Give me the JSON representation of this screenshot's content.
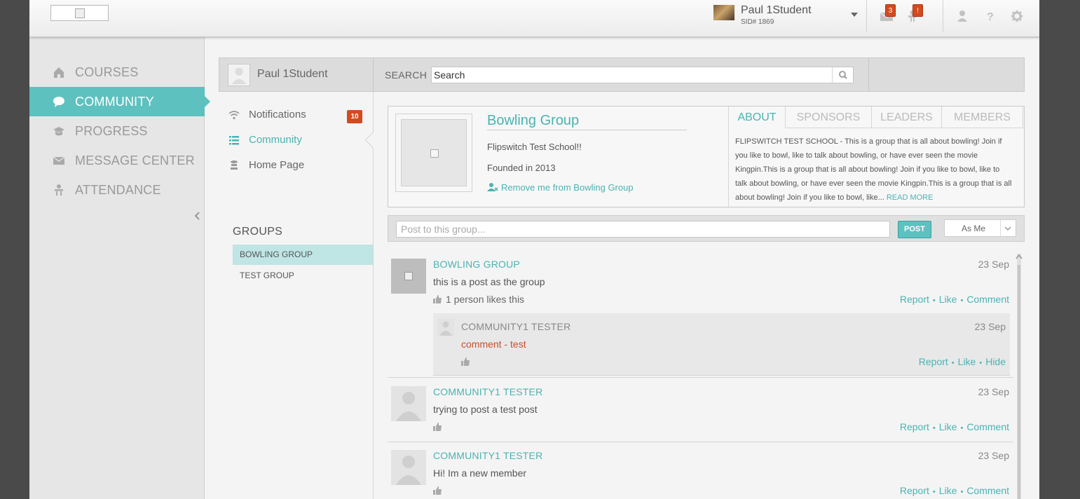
{
  "colors": {
    "accent": "#5dc1c0",
    "badge": "#d34a1f",
    "comment_text": "#c8502a"
  },
  "topbar": {
    "user_name": "Paul 1Student",
    "user_sid": "SID# 1869",
    "messages_badge": "3",
    "alerts_badge": "!",
    "icons": [
      "mail-icon",
      "alert-person-icon",
      "profile-icon",
      "help-icon",
      "settings-icon"
    ]
  },
  "sidebar": {
    "items": [
      {
        "label": "COURSES",
        "icon": "home-icon"
      },
      {
        "label": "COMMUNITY",
        "icon": "speech-bubble-icon",
        "active": true
      },
      {
        "label": "PROGRESS",
        "icon": "graduation-cap-icon"
      },
      {
        "label": "MESSAGE CENTER",
        "icon": "envelope-icon"
      },
      {
        "label": "ATTENDANCE",
        "icon": "person-desk-icon"
      }
    ]
  },
  "header": {
    "profile_name": "Paul 1Student",
    "search_label": "SEARCH",
    "search_value": "Search"
  },
  "subnav": {
    "items": [
      {
        "label": "Notifications",
        "icon": "wifi-icon"
      },
      {
        "label": "Community",
        "icon": "list-icon",
        "active": true
      },
      {
        "label": "Home Page",
        "icon": "stack-icon"
      }
    ],
    "notifications_badge": "10",
    "groups_heading": "GROUPS",
    "groups": [
      {
        "label": "BOWLING GROUP",
        "active": true
      },
      {
        "label": "TEST GROUP"
      }
    ]
  },
  "group": {
    "title": "Bowling Group",
    "school": "Flipswitch Test School!!",
    "founded": "Founded in 2013",
    "remove_label": "Remove me from Bowling Group",
    "tabs": [
      "ABOUT",
      "SPONSORS",
      "LEADERS",
      "MEMBERS"
    ],
    "about": "FLIPSWITCH TEST SCHOOL - This is a group that is all about bowling! Join if you like to bowl, like to talk about bowling, or have ever seen the movie Kingpin.This is a group that is all about bowling! Join if you like to bowl, like to talk about bowling, or have ever seen the movie Kingpin.This is a group that is all about bowling! Join if you like to bowl, like...",
    "read_more": "READ MORE"
  },
  "composer": {
    "placeholder": "Post to this group...",
    "post_label": "POST",
    "as_label": "As Me"
  },
  "feed": {
    "posts": [
      {
        "author": "BOWLING GROUP",
        "date": "23 Sep",
        "text": "this is a post as the group",
        "likes": "1 person likes this",
        "actions": [
          "Report",
          "Like",
          "Comment"
        ],
        "comment": {
          "author": "COMMUNITY1 TESTER",
          "date": "23 Sep",
          "text": "comment - test",
          "actions": [
            "Report",
            "Like",
            "Hide"
          ]
        }
      },
      {
        "author": "COMMUNITY1 TESTER",
        "date": "23 Sep",
        "text": "trying to post a test post",
        "actions": [
          "Report",
          "Like",
          "Comment"
        ]
      },
      {
        "author": "COMMUNITY1 TESTER",
        "date": "23 Sep",
        "text": "Hi! Im a new member",
        "actions": [
          "Report",
          "Like",
          "Comment"
        ]
      }
    ]
  }
}
